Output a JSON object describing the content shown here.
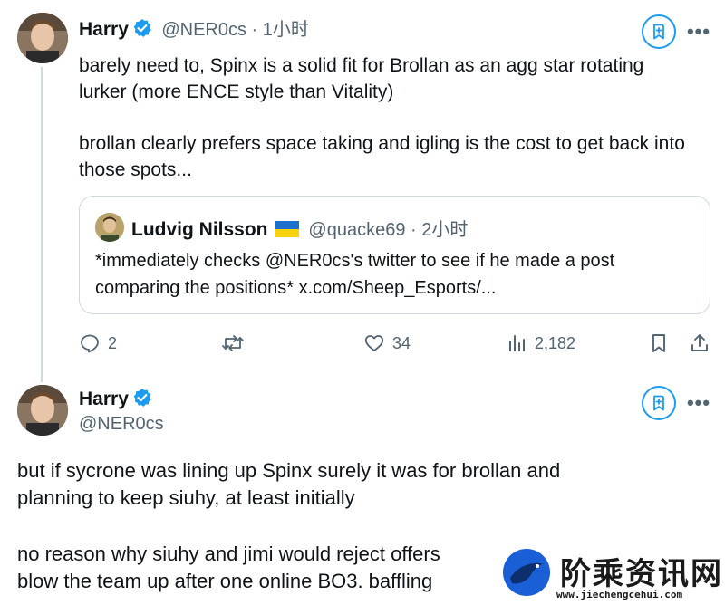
{
  "tweet1": {
    "name": "Harry",
    "handle": "@NER0cs · 1小时",
    "text_p1_line1": "barely need to, Spinx is a solid fit for Brollan as an agg star rotating",
    "text_p1_line2": "lurker (more ENCE style than Vitality)",
    "text_p2_line1": "brollan clearly prefers space taking and igling is the cost to get back into",
    "text_p2_line2": "those spots...",
    "quote": {
      "name": "Ludvig Nilsson",
      "flag": "ukraine-flag",
      "handle": "@quacke69 · 2小时",
      "line1": "*immediately checks @NER0cs's twitter to see if he made a post",
      "line2": "comparing the positions* x.com/Sheep_Esports/..."
    },
    "actions": {
      "replies": "2",
      "likes": "34",
      "views": "2,182"
    }
  },
  "tweet2": {
    "name": "Harry",
    "handle": "@NER0cs",
    "text_p1_line1": "but if sycrone was lining up Spinx surely it was for brollan and",
    "text_p1_line2": "planning to keep siuhy, at least initially",
    "text_p2_line1": "no reason why siuhy and jimi would reject offers",
    "text_p2_line2": "blow the team up after one online BO3. baffling"
  },
  "more_label": "•••",
  "watermark": {
    "title": "阶乘资讯网",
    "url": "www.jiechengcehui.com"
  },
  "colors": {
    "verified": "#1d9bf0",
    "secondary_text": "#536471",
    "border": "#cfd9de",
    "accent": "#1d9bf0"
  }
}
